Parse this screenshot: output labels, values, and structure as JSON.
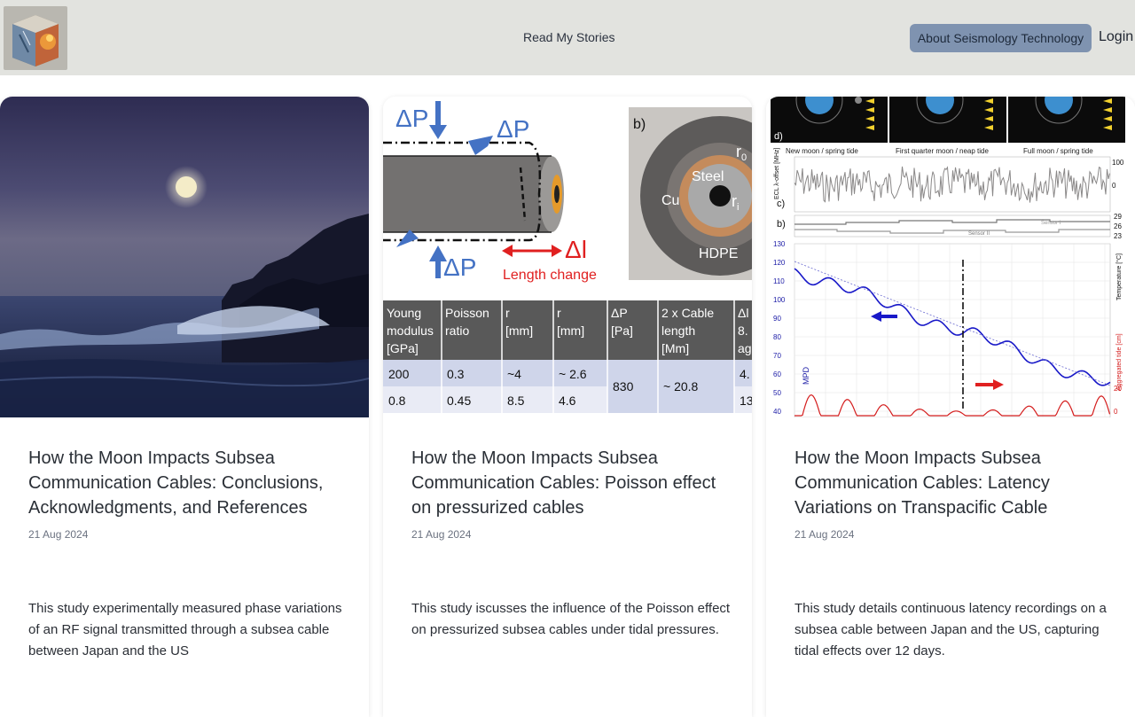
{
  "header": {
    "nav_center": "Read My Stories",
    "about_button": "About Seismology Technology",
    "login": "Login"
  },
  "cards": [
    {
      "title": "How the Moon Impacts Subsea Communication Cables: Conclusions, Acknowledgments, and References",
      "date": "21 Aug 2024",
      "description": "This study experimentally measured phase variations of an RF signal transmitted through a subsea cable between Japan and the US"
    },
    {
      "title": "How the Moon Impacts Subsea Communication Cables: Poisson effect on pressurized cables",
      "date": "21 Aug 2024",
      "description": "This study iscusses the influence of the Poisson effect on pressurized subsea cables under tidal pressures.",
      "figure": {
        "dp_label": "ΔP",
        "dl_label": "Δl",
        "length_change": "Length change",
        "panel_b": "b)",
        "steel": "Steel",
        "cu": "Cu",
        "hdpe": "HDPE",
        "ro": "r",
        "ri": "r",
        "ro_sub": "0",
        "ri_sub": "i",
        "table_headers": [
          "Young modulus [GPa]",
          "Poisson ratio",
          "ro [mm]",
          "ri [mm]",
          "ΔP [Pa]",
          "2 x Cable length [Mm]",
          "Δl 8. ag"
        ],
        "table_header_lines": [
          [
            "Young",
            "modulus",
            "[GPa]"
          ],
          [
            "Poisson",
            "ratio"
          ],
          [
            "r",
            "[mm]"
          ],
          [
            "r",
            "[mm]"
          ],
          [
            "ΔP",
            "[Pa]"
          ],
          [
            "2 x Cable",
            "length",
            "[Mm]"
          ],
          [
            "Δl",
            "8.",
            "ag"
          ]
        ],
        "table_rows": [
          [
            "200",
            "0.3",
            "~4",
            "~ 2.6",
            "830",
            "~ 20.8",
            "4."
          ],
          [
            "0.8",
            "0.45",
            "8.5",
            "4.6",
            "",
            "",
            "13"
          ]
        ]
      }
    },
    {
      "title": "How the Moon Impacts Subsea Communication Cables: Latency Variations on Transpacific Cable",
      "date": "21 Aug 2024",
      "description": "This study details continuous latency recordings on a subsea cable between Japan and the US, capturing tidal effects over 12 days.",
      "figure": {
        "panel_d": "d)",
        "panel_c": "c)",
        "panel_b": "b)",
        "moon_labels": [
          "New moon / spring tide",
          "First quarter moon / neap tide",
          "Full moon / spring tide"
        ],
        "y_ticks": [
          "130",
          "120",
          "110",
          "100",
          "90",
          "80",
          "70",
          "60",
          "50",
          "40"
        ],
        "right_ticks_top": [
          "100",
          "0"
        ],
        "right_ticks_mid": [
          "29",
          "26",
          "23"
        ],
        "right_ticks_bottom": [
          "20",
          "0"
        ],
        "ecl_label": "ECL λ-offset [MHz]",
        "temp_label": "Temperature [°C]",
        "tide_label": "Aggregated tide [cm]",
        "mpd_label": "MPD",
        "sensor_1": "Sensor I",
        "sensor_2": "Sensor II"
      }
    }
  ]
}
